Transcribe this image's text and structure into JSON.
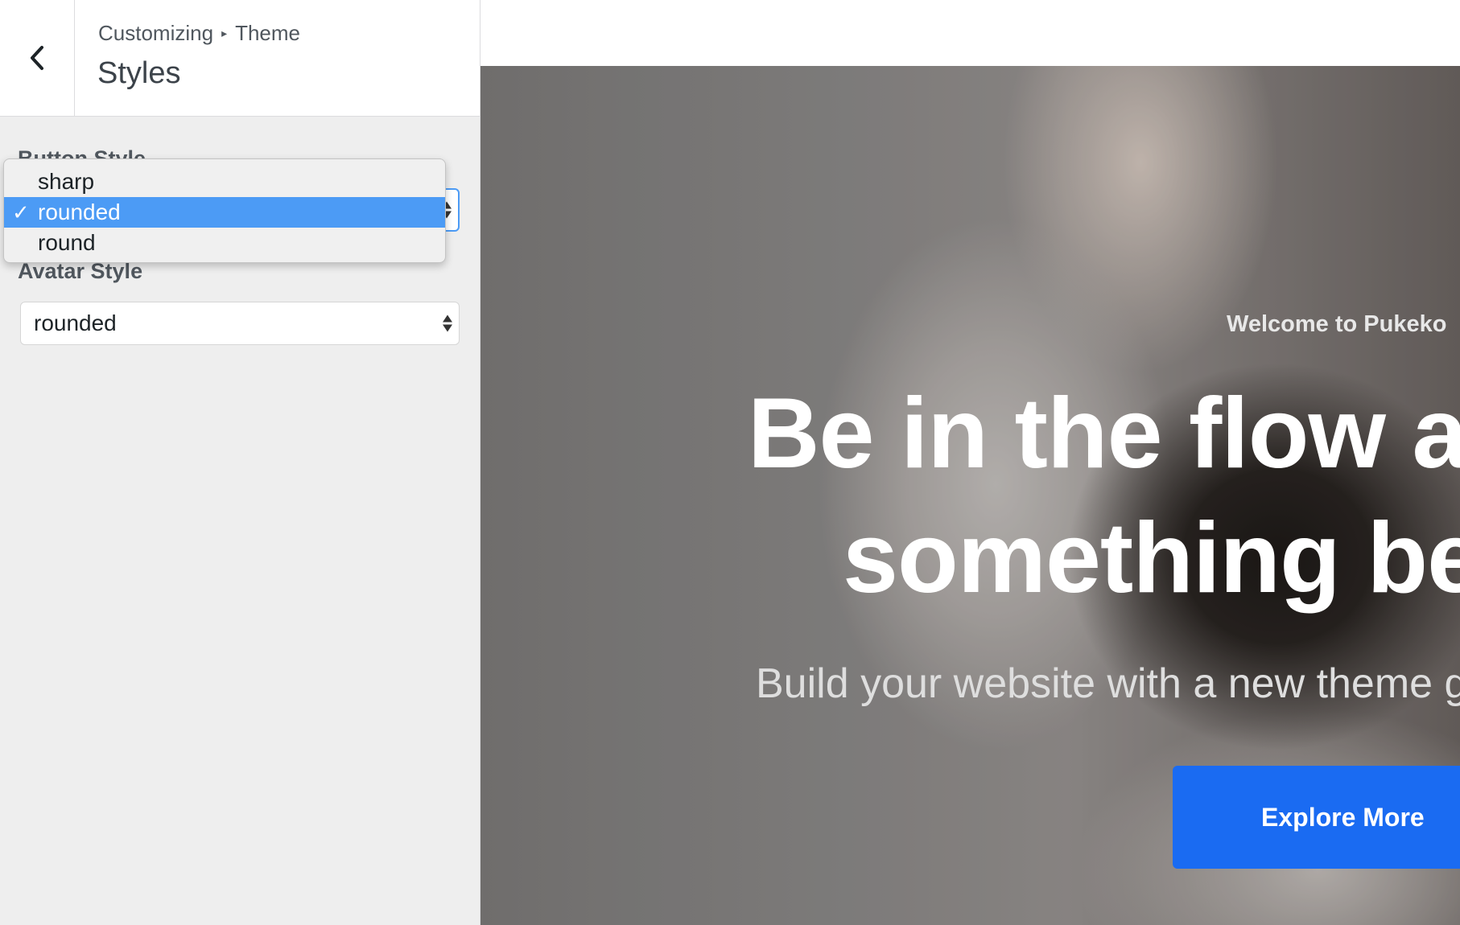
{
  "header": {
    "breadcrumb_parent": "Customizing",
    "breadcrumb_separator": "▸",
    "breadcrumb_child": "Theme",
    "section_title": "Styles",
    "back_icon": "chevron-left-icon"
  },
  "controls": {
    "button_style": {
      "label": "Button Style",
      "value": "rounded",
      "options": [
        "sharp",
        "rounded",
        "round"
      ],
      "selected_index": 1
    },
    "avatar_style": {
      "label": "Avatar Style",
      "value": "rounded"
    }
  },
  "dropdown": {
    "check_mark": "✓",
    "items": [
      {
        "label": "sharp"
      },
      {
        "label": "rounded"
      },
      {
        "label": "round"
      }
    ]
  },
  "preview": {
    "welcome": "Welcome to Pukeko",
    "headline_line1": "Be in the flow a",
    "headline_line2": "something be",
    "subtitle": "Build your website with a new theme g",
    "cta_label": "Explore More"
  },
  "colors": {
    "accent": "#4c9bf5",
    "cta": "#1a6bf2",
    "panel_bg": "#eeeeee"
  }
}
